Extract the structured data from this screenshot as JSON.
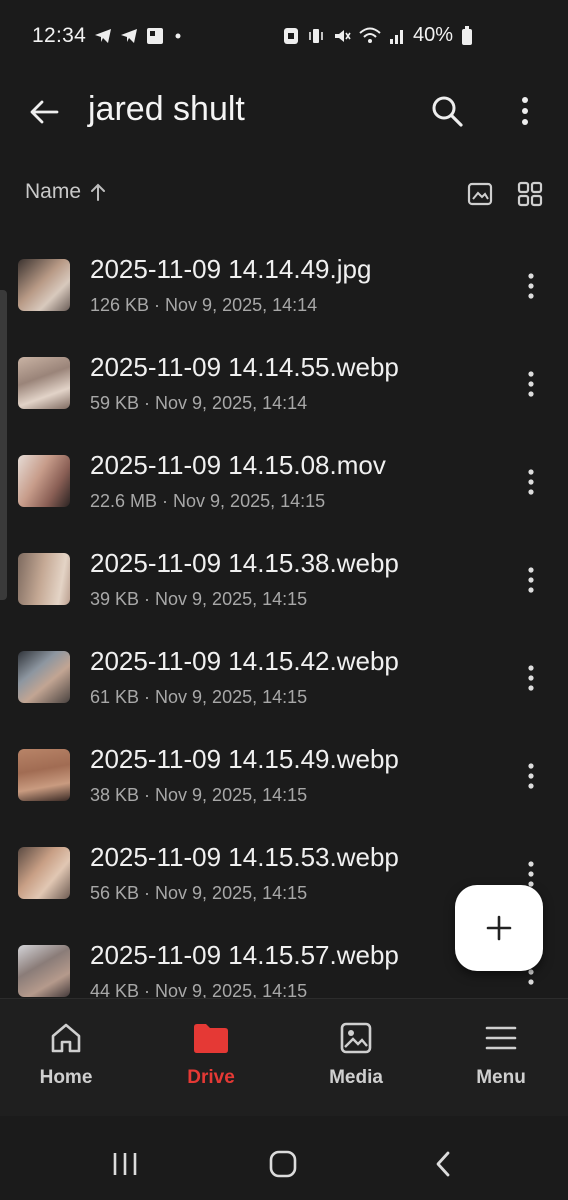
{
  "status_bar": {
    "time": "12:34",
    "battery": "40%",
    "icons_left": [
      "telegram-icon",
      "telegram-icon",
      "gallery-icon",
      "dot-icon"
    ],
    "icons_right": [
      "nfc-icon",
      "vibrate-icon",
      "mute-icon",
      "wifi-icon",
      "signal-icon",
      "battery-icon"
    ]
  },
  "header": {
    "title": "jared shult"
  },
  "sort": {
    "label": "Name"
  },
  "files": [
    {
      "name": "2025-11-09 14.14.49.jpg",
      "meta": "126 KB · Nov 9, 2025, 14:14"
    },
    {
      "name": "2025-11-09 14.14.55.webp",
      "meta": "59 KB · Nov 9, 2025, 14:14"
    },
    {
      "name": "2025-11-09 14.15.08.mov",
      "meta": "22.6 MB · Nov 9, 2025, 14:15"
    },
    {
      "name": "2025-11-09 14.15.38.webp",
      "meta": "39 KB · Nov 9, 2025, 14:15"
    },
    {
      "name": "2025-11-09 14.15.42.webp",
      "meta": "61 KB · Nov 9, 2025, 14:15"
    },
    {
      "name": "2025-11-09 14.15.49.webp",
      "meta": "38 KB · Nov 9, 2025, 14:15"
    },
    {
      "name": "2025-11-09 14.15.53.webp",
      "meta": "56 KB · Nov 9, 2025, 14:15"
    },
    {
      "name": "2025-11-09 14.15.57.webp",
      "meta": "44 KB · Nov 9, 2025, 14:15"
    }
  ],
  "bottom_nav": {
    "home": "Home",
    "drive": "Drive",
    "media": "Media",
    "menu": "Menu",
    "active": "drive"
  },
  "colors": {
    "background": "#1b1b1b",
    "accent": "#e53935",
    "fab": "#ffffff"
  }
}
